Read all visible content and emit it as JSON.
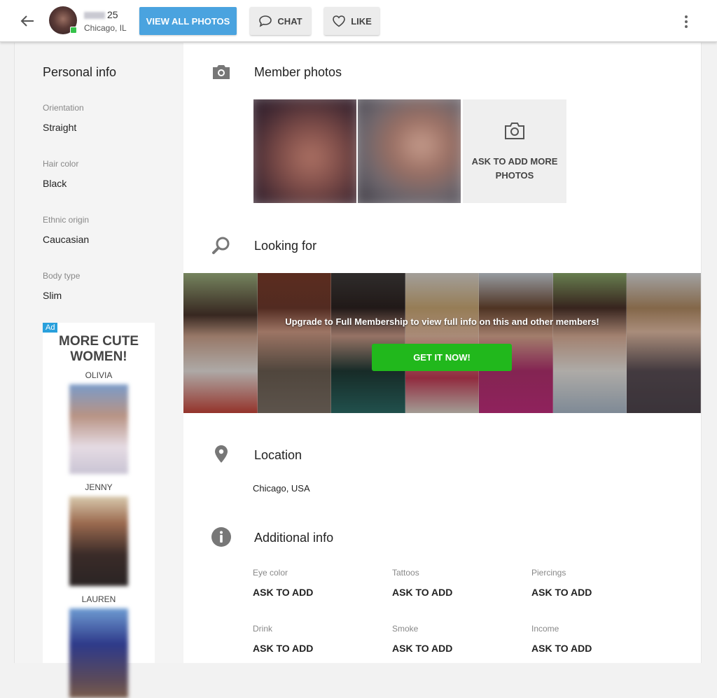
{
  "header": {
    "user_age": "25",
    "user_location": "Chicago, IL",
    "view_all_photos_label": "VIEW ALL PHOTOS",
    "chat_label": "CHAT",
    "like_label": "LIKE",
    "accent_color": "#4aa3df",
    "online_color": "#35c24a"
  },
  "personal_info": {
    "title": "Personal info",
    "fields": [
      {
        "label": "Orientation",
        "value": "Straight"
      },
      {
        "label": "Hair color",
        "value": "Black"
      },
      {
        "label": "Ethnic origin",
        "value": "Caucasian"
      },
      {
        "label": "Body type",
        "value": "Slim"
      }
    ]
  },
  "ad": {
    "badge": "Ad",
    "title": "MORE CUTE WOMEN!",
    "profiles": [
      {
        "name": "OLIVIA"
      },
      {
        "name": "JENNY"
      },
      {
        "name": "LAUREN"
      }
    ]
  },
  "member_photos": {
    "title": "Member photos",
    "ask_more_label": "ASK TO ADD MORE PHOTOS"
  },
  "looking_for": {
    "title": "Looking for",
    "upgrade_text": "Upgrade to Full Membership to view full info on this and other members!",
    "cta_label": "GET IT NOW!",
    "cta_color": "#21b81c"
  },
  "location": {
    "title": "Location",
    "value": "Chicago, USA"
  },
  "additional_info": {
    "title": "Additional info",
    "fields": [
      {
        "label": "Eye color",
        "value": "ASK TO ADD"
      },
      {
        "label": "Tattoos",
        "value": "ASK TO ADD"
      },
      {
        "label": "Piercings",
        "value": "ASK TO ADD"
      },
      {
        "label": "Drink",
        "value": "ASK TO ADD"
      },
      {
        "label": "Smoke",
        "value": "ASK TO ADD"
      },
      {
        "label": "Income",
        "value": "ASK TO ADD"
      }
    ]
  }
}
